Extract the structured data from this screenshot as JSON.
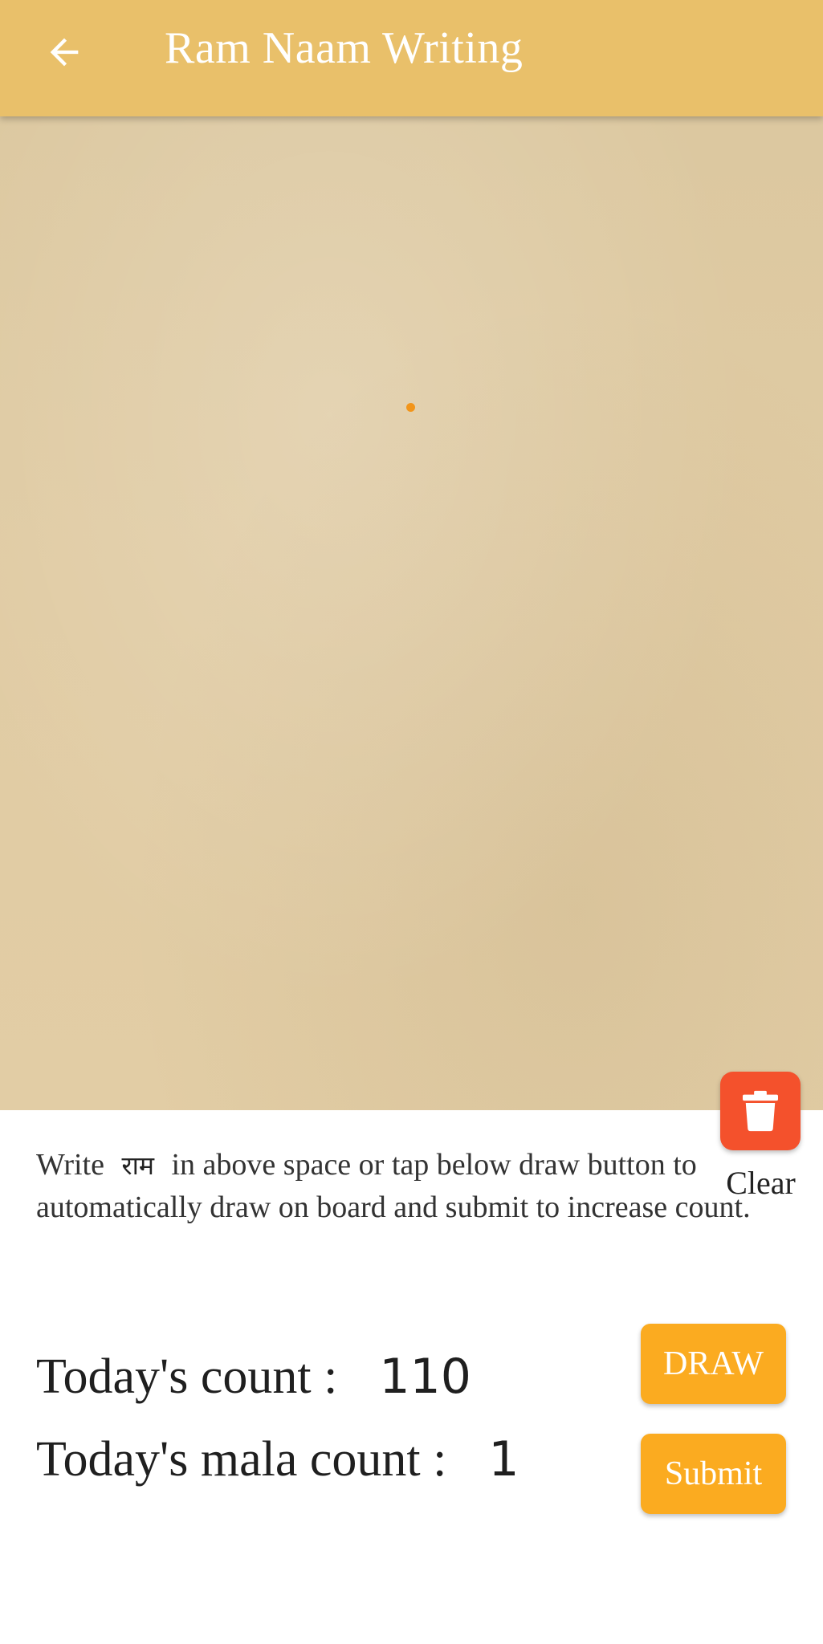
{
  "appbar": {
    "title": "Ram Naam Writing",
    "back_icon": "arrow-left-icon",
    "color": "#e9c06a"
  },
  "board": {
    "background": "paper-texture",
    "dot_color": "#f2951a",
    "clear_icon": "trash-icon",
    "clear_label": "Clear",
    "clear_color": "#f4512c"
  },
  "instruction": {
    "before": "Write",
    "hindi_word": "राम",
    "after": "in above space or tap below draw button to automatically draw on board and submit to increase count."
  },
  "counts": {
    "today_label": "Today's count :",
    "today_value": "110",
    "mala_label": "Today's mala count :",
    "mala_value": "1"
  },
  "buttons": {
    "draw_label": "DRAW",
    "submit_label": "Submit",
    "color": "#fbab20"
  }
}
